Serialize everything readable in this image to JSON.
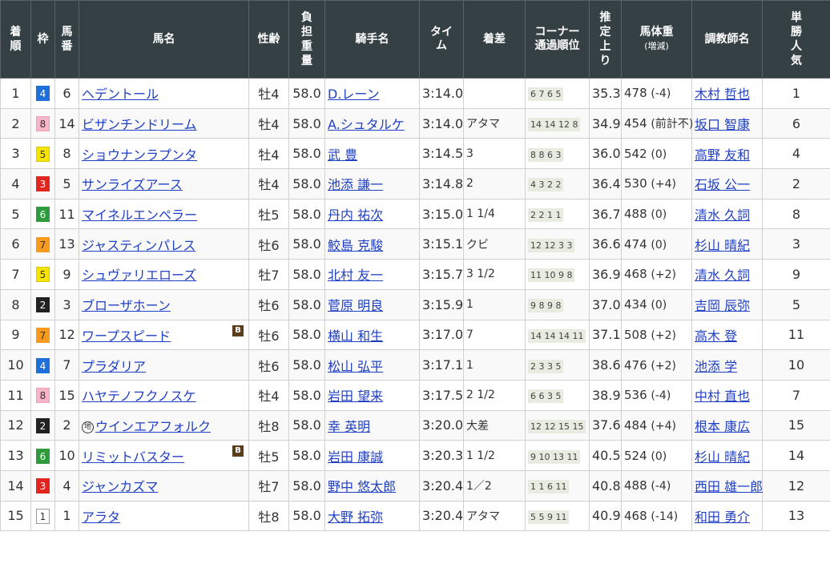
{
  "headers": {
    "rank": [
      "着",
      "順"
    ],
    "waku": "枠",
    "umaban": [
      "馬",
      "番"
    ],
    "horse": "馬名",
    "sexage": "性齢",
    "weight_carried": [
      "負",
      "担",
      "重",
      "量"
    ],
    "jockey": "騎手名",
    "time": [
      "タイ",
      "ム"
    ],
    "margin": "着差",
    "corner": [
      "コーナー",
      "通過順位"
    ],
    "last3f": [
      "推",
      "定",
      "上",
      "り"
    ],
    "bodyweight": [
      "馬体重",
      "(増減)"
    ],
    "trainer": "調教師名",
    "pop": [
      "単",
      "勝",
      "人",
      "気"
    ]
  },
  "rows": [
    {
      "rank": "1",
      "waku": "4",
      "umaban": "6",
      "horse": "ヘデントール",
      "mark": "",
      "sexage": "牡4",
      "kg": "58.0",
      "jockey": "D.レーン",
      "time": "3:14.0",
      "margin": "",
      "corner": "6 7 6 5",
      "last3f": "35.3",
      "bw": "478",
      "bwd": "(-4)",
      "trainer": "木村 哲也",
      "pop": "1"
    },
    {
      "rank": "2",
      "waku": "8",
      "umaban": "14",
      "horse": "ビザンチンドリーム",
      "mark": "",
      "sexage": "牡4",
      "kg": "58.0",
      "jockey": "A.シュタルケ",
      "time": "3:14.0",
      "margin": "アタマ",
      "corner": "14 14 12 8",
      "last3f": "34.9",
      "bw": "454",
      "bwd": "(前計不)",
      "trainer": "坂口 智康",
      "pop": "6"
    },
    {
      "rank": "3",
      "waku": "5",
      "umaban": "8",
      "horse": "ショウナンラプンタ",
      "mark": "",
      "sexage": "牡4",
      "kg": "58.0",
      "jockey": "武 豊",
      "time": "3:14.5",
      "margin": "3",
      "corner": "8 8 6 3",
      "last3f": "36.0",
      "bw": "542",
      "bwd": "(0)",
      "trainer": "高野 友和",
      "pop": "4"
    },
    {
      "rank": "4",
      "waku": "3",
      "umaban": "5",
      "horse": "サンライズアース",
      "mark": "",
      "sexage": "牡4",
      "kg": "58.0",
      "jockey": "池添 謙一",
      "time": "3:14.8",
      "margin": "2",
      "corner": "4 3 2 2",
      "last3f": "36.4",
      "bw": "530",
      "bwd": "(+4)",
      "trainer": "石坂 公一",
      "pop": "2"
    },
    {
      "rank": "5",
      "waku": "6",
      "umaban": "11",
      "horse": "マイネルエンペラー",
      "mark": "",
      "sexage": "牡5",
      "kg": "58.0",
      "jockey": "丹内 祐次",
      "time": "3:15.0",
      "margin": "1 1/4",
      "corner": "2 2 1 1",
      "last3f": "36.7",
      "bw": "488",
      "bwd": "(0)",
      "trainer": "清水 久詞",
      "pop": "8"
    },
    {
      "rank": "6",
      "waku": "7",
      "umaban": "13",
      "horse": "ジャスティンパレス",
      "mark": "",
      "sexage": "牡6",
      "kg": "58.0",
      "jockey": "鮫島 克駿",
      "time": "3:15.1",
      "margin": "クビ",
      "corner": "12 12 3 3",
      "last3f": "36.6",
      "bw": "474",
      "bwd": "(0)",
      "trainer": "杉山 晴紀",
      "pop": "3"
    },
    {
      "rank": "7",
      "waku": "5",
      "umaban": "9",
      "horse": "シュヴァリエローズ",
      "mark": "",
      "sexage": "牡7",
      "kg": "58.0",
      "jockey": "北村 友一",
      "time": "3:15.7",
      "margin": "3 1/2",
      "corner": "11 10 9 8",
      "last3f": "36.9",
      "bw": "468",
      "bwd": "(+2)",
      "trainer": "清水 久詞",
      "pop": "9"
    },
    {
      "rank": "8",
      "waku": "2",
      "umaban": "3",
      "horse": "ブローザホーン",
      "mark": "",
      "sexage": "牡6",
      "kg": "58.0",
      "jockey": "菅原 明良",
      "time": "3:15.9",
      "margin": "1",
      "corner": "9 8 9 8",
      "last3f": "37.0",
      "bw": "434",
      "bwd": "(0)",
      "trainer": "吉岡 辰弥",
      "pop": "5"
    },
    {
      "rank": "9",
      "waku": "7",
      "umaban": "12",
      "horse": "ワープスピード",
      "mark": "B",
      "sexage": "牡6",
      "kg": "58.0",
      "jockey": "横山 和生",
      "time": "3:17.0",
      "margin": "7",
      "corner": "14 14 14 11",
      "last3f": "37.1",
      "bw": "508",
      "bwd": "(+2)",
      "trainer": "高木 登",
      "pop": "11"
    },
    {
      "rank": "10",
      "waku": "4",
      "umaban": "7",
      "horse": "プラダリア",
      "mark": "",
      "sexage": "牡6",
      "kg": "58.0",
      "jockey": "松山 弘平",
      "time": "3:17.1",
      "margin": "1",
      "corner": "2 3 3 5",
      "last3f": "38.6",
      "bw": "476",
      "bwd": "(+2)",
      "trainer": "池添 学",
      "pop": "10"
    },
    {
      "rank": "11",
      "waku": "8",
      "umaban": "15",
      "horse": "ハヤテノフクノスケ",
      "mark": "",
      "sexage": "牡4",
      "kg": "58.0",
      "jockey": "岩田 望来",
      "time": "3:17.5",
      "margin": "2 1/2",
      "corner": "6 6 3 5",
      "last3f": "38.9",
      "bw": "536",
      "bwd": "(-4)",
      "trainer": "中村 直也",
      "pop": "7"
    },
    {
      "rank": "12",
      "waku": "2",
      "umaban": "2",
      "horse": "ウインエアフォルク",
      "mark": "地",
      "sexage": "牡8",
      "kg": "58.0",
      "jockey": "幸 英明",
      "time": "3:20.0",
      "margin": "大差",
      "corner": "12 12 15 15",
      "last3f": "37.6",
      "bw": "484",
      "bwd": "(+4)",
      "trainer": "根本 康広",
      "pop": "15"
    },
    {
      "rank": "13",
      "waku": "6",
      "umaban": "10",
      "horse": "リミットバスター",
      "mark": "B",
      "sexage": "牡5",
      "kg": "58.0",
      "jockey": "岩田 康誠",
      "time": "3:20.3",
      "margin": "1 1/2",
      "corner": "9 10 13 11",
      "last3f": "40.5",
      "bw": "524",
      "bwd": "(0)",
      "trainer": "杉山 晴紀",
      "pop": "14"
    },
    {
      "rank": "14",
      "waku": "3",
      "umaban": "4",
      "horse": "ジャンカズマ",
      "mark": "",
      "sexage": "牡7",
      "kg": "58.0",
      "jockey": "野中 悠太郎",
      "time": "3:20.4",
      "margin": "1／2",
      "corner": "1 1 6 11",
      "last3f": "40.8",
      "bw": "488",
      "bwd": "(-4)",
      "trainer": "西田 雄一郎",
      "pop": "12"
    },
    {
      "rank": "15",
      "waku": "1",
      "umaban": "1",
      "horse": "アラタ",
      "mark": "",
      "sexage": "牡8",
      "kg": "58.0",
      "jockey": "大野 拓弥",
      "time": "3:20.4",
      "margin": "アタマ",
      "corner": "5 5 9 11",
      "last3f": "40.9",
      "bw": "468",
      "bwd": "(-14)",
      "trainer": "和田 勇介",
      "pop": "13"
    }
  ],
  "waku_colors": {
    "1": {
      "bg": "#ffffff",
      "fg": "#333333",
      "border": "#999999"
    },
    "2": {
      "bg": "#222222",
      "fg": "#ffffff",
      "border": "#222222"
    },
    "3": {
      "bg": "#e0261e",
      "fg": "#ffffff",
      "border": "#e0261e"
    },
    "4": {
      "bg": "#1e6fd9",
      "fg": "#ffffff",
      "border": "#1e6fd9"
    },
    "5": {
      "bg": "#f5e400",
      "fg": "#333333",
      "border": "#d8c800"
    },
    "6": {
      "bg": "#2e9b3c",
      "fg": "#ffffff",
      "border": "#2e9b3c"
    },
    "7": {
      "bg": "#f79a1e",
      "fg": "#333333",
      "border": "#f79a1e"
    },
    "8": {
      "bg": "#f6b6c8",
      "fg": "#333333",
      "border": "#f0a0b8"
    }
  }
}
